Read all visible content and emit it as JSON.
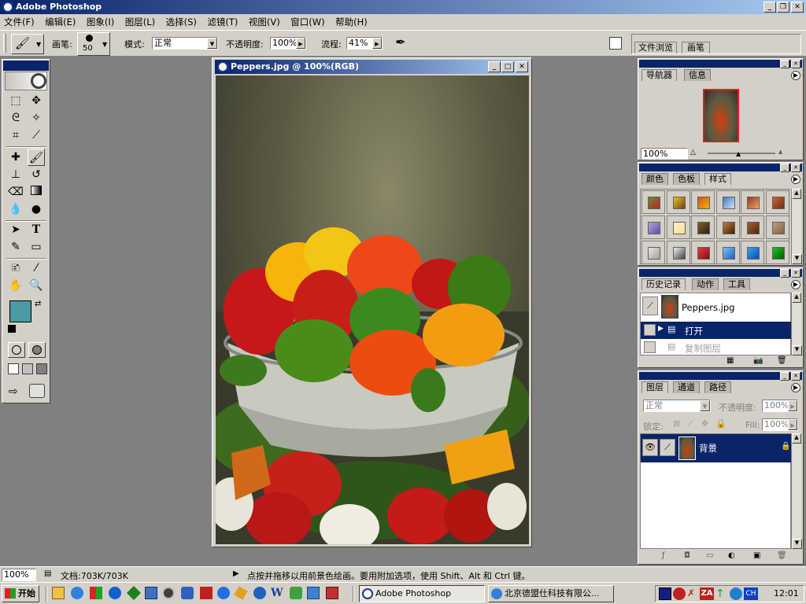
{
  "window": {
    "title": "Adobe Photoshop"
  },
  "menu": [
    "文件(F)",
    "编辑(E)",
    "图象(I)",
    "图层(L)",
    "选择(S)",
    "滤镜(T)",
    "视图(V)",
    "窗口(W)",
    "帮助(H)"
  ],
  "options": {
    "brush_label": "画笔:",
    "brush_size": "50",
    "mode_label": "模式:",
    "mode_value": "正常",
    "opacity_label": "不透明度:",
    "opacity_value": "100%",
    "flow_label": "流程:",
    "flow_value": "41%"
  },
  "palette_well": {
    "tabs": [
      "文件浏览",
      "画笔"
    ]
  },
  "document": {
    "title": "Peppers.jpg @ 100%(RGB)"
  },
  "navigator": {
    "tabs": [
      "导航器",
      "信息"
    ],
    "zoom": "100%"
  },
  "color_palette": {
    "tabs": [
      "颜色",
      "色板",
      "样式"
    ]
  },
  "styles": [
    {
      "a": "#6a8a3a",
      "b": "#c02020"
    },
    {
      "a": "#f0c020",
      "b": "#704010"
    },
    {
      "a": "#e05020",
      "b": "#f0b000"
    },
    {
      "a": "#4080c0",
      "b": "#d0e0f0"
    },
    {
      "a": "#904020",
      "b": "#f0a060"
    },
    {
      "a": "#d06030",
      "b": "#703010"
    },
    {
      "a": "#c0a0e0",
      "b": "#6050a0"
    },
    {
      "a": "#fff0c0",
      "b": "#f8e090"
    },
    {
      "a": "#806030",
      "b": "#302010"
    },
    {
      "a": "#c08040",
      "b": "#402000"
    },
    {
      "a": "#a06030",
      "b": "#502810"
    },
    {
      "a": "#c0a080",
      "b": "#806040"
    },
    {
      "a": "#e8e8e8",
      "b": "#a0a0a0"
    },
    {
      "a": "#f0f0f0",
      "b": "#404040"
    },
    {
      "a": "#e04040",
      "b": "#801010"
    },
    {
      "a": "#80c0f0",
      "b": "#2060c0"
    },
    {
      "a": "#40a0f0",
      "b": "#0050b0"
    },
    {
      "a": "#20c020",
      "b": "#006000"
    }
  ],
  "history": {
    "tabs": [
      "历史记录",
      "动作",
      "工具"
    ],
    "snapshot": "Peppers.jpg",
    "items": [
      "打开",
      "复制图层"
    ]
  },
  "layers": {
    "tabs": [
      "图层",
      "通道",
      "路径"
    ],
    "blend_mode": "正常",
    "opacity_label": "不透明度:",
    "opacity_value": "100%",
    "lock_label": "锁定:",
    "fill_label": "Fill:",
    "fill_value": "100%",
    "layer_name": "背景"
  },
  "status": {
    "zoom": "100%",
    "doc_size": "文档:703K/703K",
    "hint": "点按并拖移以用前景色绘画。要用附加选项，使用 Shift、Alt 和 Ctrl 键。"
  },
  "taskbar": {
    "start": "开始",
    "tasks": [
      "Adobe Photoshop",
      "北京德盟仕科技有限公..."
    ],
    "clock": "12:01",
    "lang": "CH",
    "za": "ZA"
  },
  "colors": {
    "foreground": "#4a9ba3",
    "background": "#c8102e",
    "title_active": "#0a246a",
    "desktop": "#808080"
  }
}
